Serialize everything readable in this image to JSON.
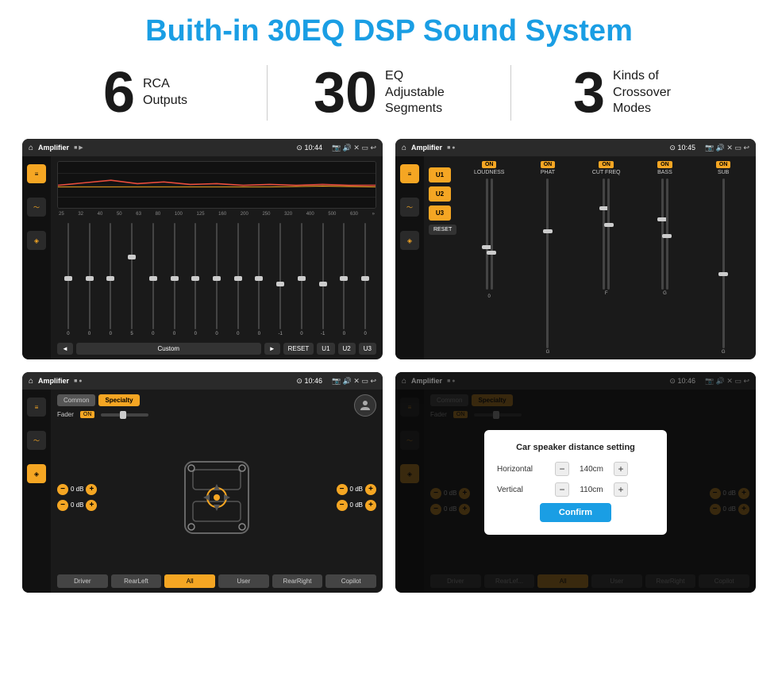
{
  "title": "Buith-in 30EQ DSP Sound System",
  "stats": [
    {
      "number": "6",
      "text": "RCA\nOutputs"
    },
    {
      "number": "30",
      "text": "EQ Adjustable\nSegments"
    },
    {
      "number": "3",
      "text": "Kinds of\nCrossover Modes"
    }
  ],
  "screens": {
    "screen1": {
      "topbar": {
        "appName": "Amplifier",
        "time": "10:44"
      },
      "eq_labels": [
        "25",
        "32",
        "40",
        "50",
        "63",
        "80",
        "100",
        "125",
        "160",
        "200",
        "250",
        "320",
        "400",
        "500",
        "630"
      ],
      "sliders": [
        0,
        0,
        0,
        5,
        0,
        0,
        0,
        0,
        0,
        0,
        -1,
        0,
        -1
      ],
      "nav_buttons": [
        "◄",
        "Custom",
        "►",
        "RESET",
        "U1",
        "U2",
        "U3"
      ]
    },
    "screen2": {
      "topbar": {
        "appName": "Amplifier",
        "time": "10:45"
      },
      "presets": [
        "U1",
        "U2",
        "U3"
      ],
      "columns": [
        "LOUDNESS",
        "PHAT",
        "CUT FREQ",
        "BASS",
        "SUB"
      ],
      "reset_label": "RESET"
    },
    "screen3": {
      "topbar": {
        "appName": "Amplifier",
        "time": "10:46"
      },
      "tabs": [
        "Common",
        "Specialty"
      ],
      "fader_label": "Fader",
      "fader_on": "ON",
      "volumes": [
        {
          "label": "0 dB"
        },
        {
          "label": "0 dB"
        },
        {
          "label": "0 dB"
        },
        {
          "label": "0 dB"
        }
      ],
      "bottom_buttons": [
        "Driver",
        "RearLeft",
        "All",
        "User",
        "RearRight",
        "Copilot"
      ]
    },
    "screen4": {
      "topbar": {
        "appName": "Amplifier",
        "time": "10:46"
      },
      "tabs": [
        "Common",
        "Specialty"
      ],
      "dialog": {
        "title": "Car speaker distance setting",
        "fields": [
          {
            "label": "Horizontal",
            "value": "140cm"
          },
          {
            "label": "Vertical",
            "value": "110cm"
          }
        ],
        "confirm_label": "Confirm"
      },
      "bottom_buttons": [
        "Driver",
        "RearLef...",
        "All",
        "User",
        "RearRight",
        "Copilot"
      ]
    }
  }
}
